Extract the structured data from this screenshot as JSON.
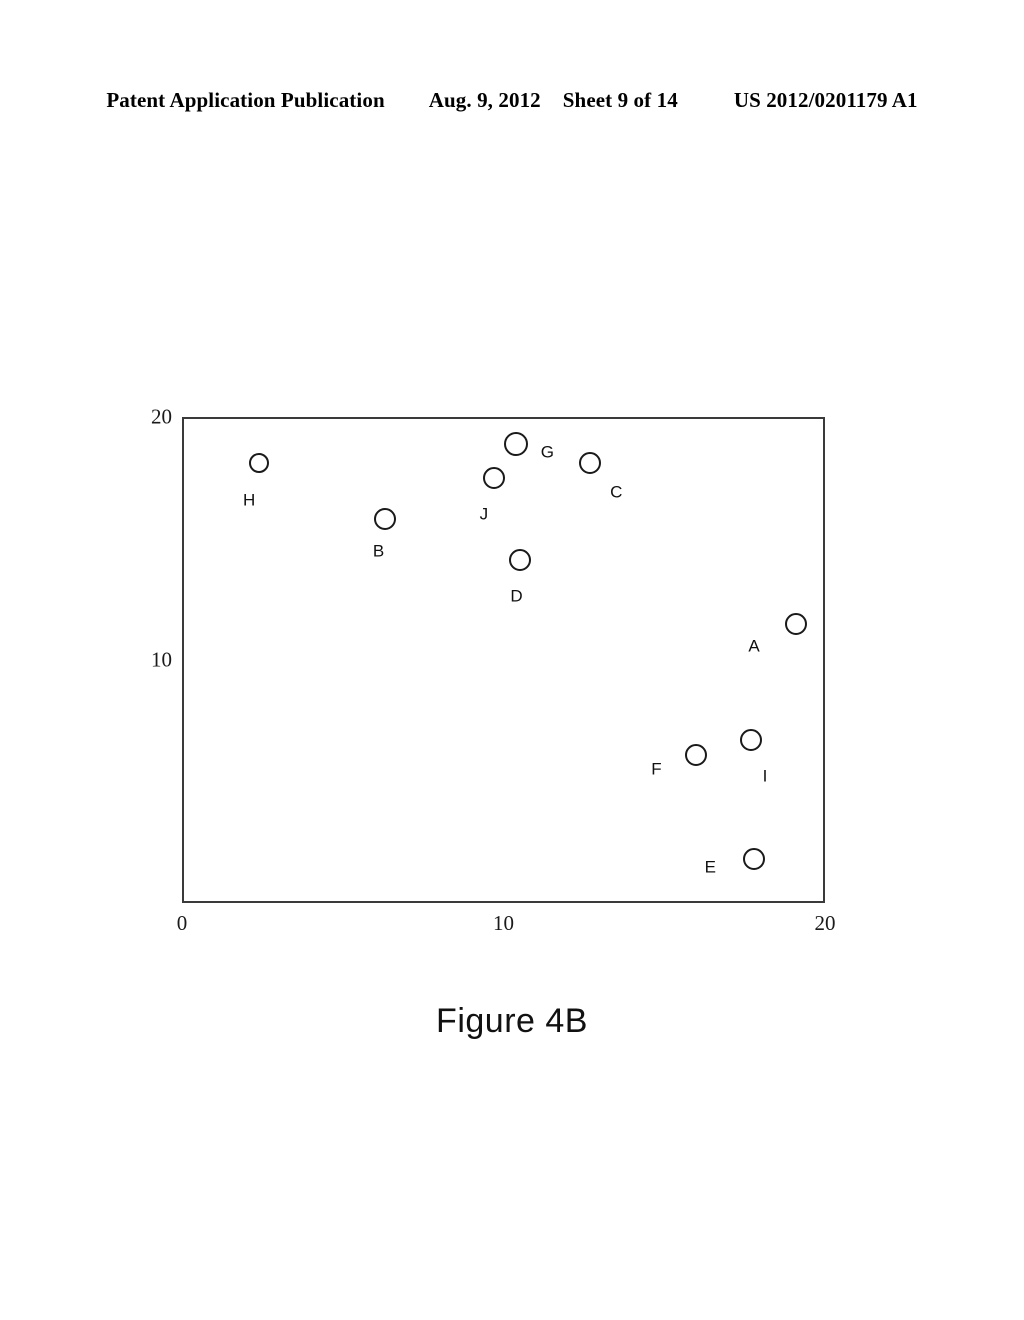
{
  "header": {
    "publication": "Patent Application Publication",
    "date": "Aug. 9, 2012",
    "sheet": "Sheet 9 of 14",
    "patent_number": "US 2012/0201179 A1"
  },
  "figure": {
    "caption": "Figure 4B"
  },
  "chart_data": {
    "type": "scatter",
    "title": "Figure 4B",
    "xlabel": "",
    "ylabel": "",
    "xlim": [
      0,
      20
    ],
    "ylim": [
      0,
      20
    ],
    "x_ticks": [
      "0",
      "10",
      "20"
    ],
    "x_tick_values": [
      0,
      10,
      20
    ],
    "y_ticks": [
      "10",
      "20"
    ],
    "y_tick_values": [
      10,
      20
    ],
    "grid": false,
    "legend": "none",
    "marker": "open-circle",
    "points": [
      {
        "label": "A",
        "x": 19.1,
        "y": 11.5,
        "r": 11,
        "label_dx": -42,
        "label_dy": 22
      },
      {
        "label": "B",
        "x": 6.3,
        "y": 15.8,
        "r": 11,
        "label_dx": -6,
        "label_dy": 32
      },
      {
        "label": "C",
        "x": 12.7,
        "y": 18.1,
        "r": 11,
        "label_dx": 26,
        "label_dy": 29
      },
      {
        "label": "D",
        "x": 10.5,
        "y": 14.1,
        "r": 11,
        "label_dx": -3,
        "label_dy": 36
      },
      {
        "label": "E",
        "x": 17.8,
        "y": 1.8,
        "r": 11,
        "label_dx": -44,
        "label_dy": 8
      },
      {
        "label": "F",
        "x": 16.0,
        "y": 6.1,
        "r": 11,
        "label_dx": -40,
        "label_dy": 14
      },
      {
        "label": "G",
        "x": 10.4,
        "y": 18.9,
        "r": 12,
        "label_dx": 31,
        "label_dy": 8
      },
      {
        "label": "H",
        "x": 2.4,
        "y": 18.1,
        "r": 10,
        "label_dx": -10,
        "label_dy": 37
      },
      {
        "label": "I",
        "x": 17.7,
        "y": 6.7,
        "r": 11,
        "label_dx": 14,
        "label_dy": 36
      },
      {
        "label": "J",
        "x": 9.7,
        "y": 17.5,
        "r": 11,
        "label_dx": -10,
        "label_dy": 36
      }
    ]
  }
}
